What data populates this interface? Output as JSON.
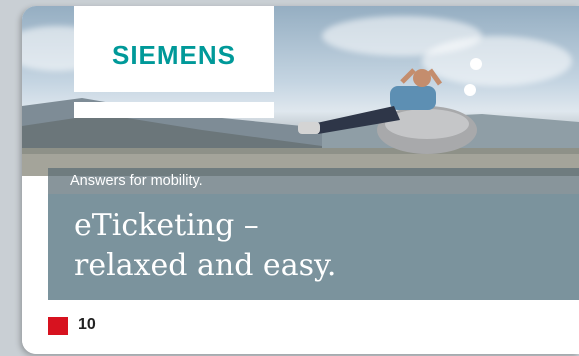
{
  "brand": {
    "logo_text": "SIEMENS",
    "logo_color": "#009999"
  },
  "tagline": "Answers for mobility.",
  "headline": {
    "line1": "eTicketing –",
    "line2": "relaxed and easy."
  },
  "footer": {
    "marker_color": "#d7121f",
    "page_number": "10"
  },
  "photo": {
    "description_icon": "man-relaxing-on-beanbag-icon"
  }
}
